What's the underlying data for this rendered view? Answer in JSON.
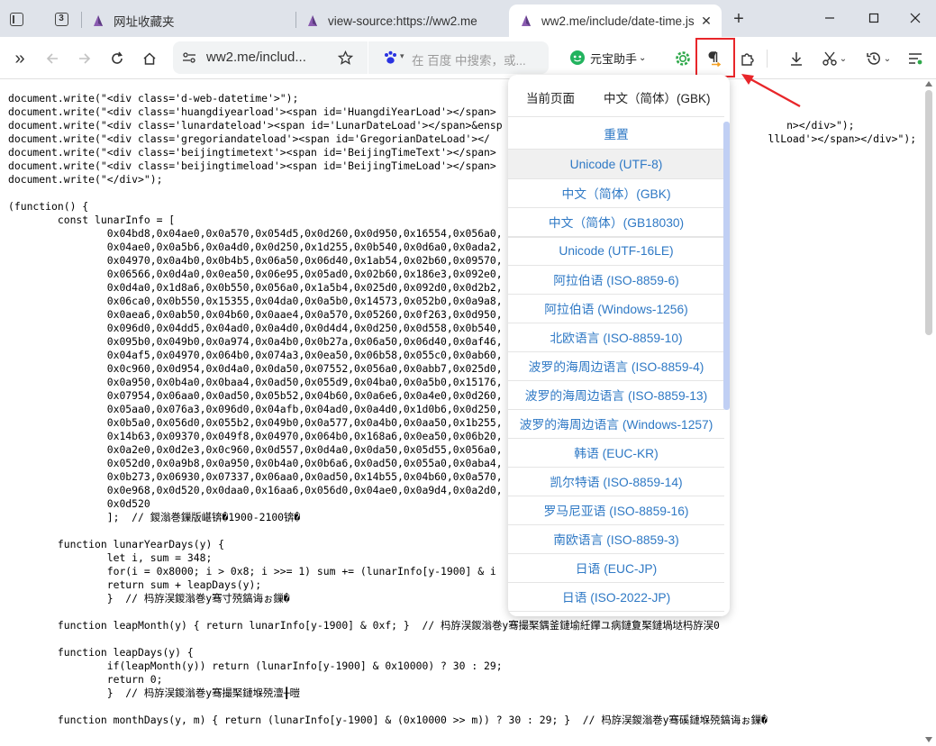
{
  "tabs": [
    {
      "title": "网址收藏夹"
    },
    {
      "title": "view-source:https://ww2.me"
    },
    {
      "title": "ww2.me/include/date-time.js"
    }
  ],
  "tab_counter": "3",
  "address_bar": {
    "url": "ww2.me/includ..."
  },
  "search_box": {
    "placeholder": "在 百度 中搜索，或..."
  },
  "assistant": {
    "label": "元宝助手"
  },
  "encoding_menu": {
    "header_left": "当前页面",
    "header_right": "中文（简体）(GBK)",
    "reset": "重置",
    "items": [
      "Unicode (UTF-8)",
      "中文（简体）(GBK)",
      "中文（简体）(GB18030)",
      "Unicode (UTF-16LE)",
      "阿拉伯语 (ISO-8859-6)",
      "阿拉伯语 (Windows-1256)",
      "北欧语言 (ISO-8859-10)",
      "波罗的海周边语言 (ISO-8859-4)",
      "波罗的海周边语言 (ISO-8859-13)",
      "波罗的海周边语言 (Windows-1257)",
      "韩语 (EUC-KR)",
      "凯尔特语 (ISO-8859-14)",
      "罗马尼亚语 (ISO-8859-16)",
      "南欧语言 (ISO-8859-3)",
      "日语 (EUC-JP)",
      "日语 (ISO-2022-JP)"
    ],
    "selected": "Unicode (UTF-8)"
  },
  "source_lines": [
    "document.write(\"<div class='d-web-datetime'>\");",
    "document.write(\"<div class='huangdiyearload'><span id='HuangdiYearLoad'></span>",
    "document.write(\"<div class='lunardateload'><span id='LunarDateLoad'></span>&ensp                                              n></div>\");",
    "document.write(\"<div class='gregoriandateload'><span id='GregorianDateLoad'></                                             llLoad'></span></div>\");",
    "document.write(\"<div class='beijingtimetext'><span id='BeijingTimeText'></span>",
    "document.write(\"<div class='beijingtimeload'><span id='BeijingTimeLoad'></span>",
    "document.write(\"</div>\");",
    "",
    "(function() {",
    "        const lunarInfo = [",
    "                0x04bd8,0x04ae0,0x0a570,0x054d5,0x0d260,0x0d950,0x16554,0x056a0,",
    "                0x04ae0,0x0a5b6,0x0a4d0,0x0d250,0x1d255,0x0b540,0x0d6a0,0x0ada2,",
    "                0x04970,0x0a4b0,0x0b4b5,0x06a50,0x06d40,0x1ab54,0x02b60,0x09570,",
    "                0x06566,0x0d4a0,0x0ea50,0x06e95,0x05ad0,0x02b60,0x186e3,0x092e0,",
    "                0x0d4a0,0x1d8a6,0x0b550,0x056a0,0x1a5b4,0x025d0,0x092d0,0x0d2b2,",
    "                0x06ca0,0x0b550,0x15355,0x04da0,0x0a5b0,0x14573,0x052b0,0x0a9a8,",
    "                0x0aea6,0x0ab50,0x04b60,0x0aae4,0x0a570,0x05260,0x0f263,0x0d950,",
    "                0x096d0,0x04dd5,0x04ad0,0x0a4d0,0x0d4d4,0x0d250,0x0d558,0x0b540,",
    "                0x095b0,0x049b0,0x0a974,0x0a4b0,0x0b27a,0x06a50,0x06d40,0x0af46,",
    "                0x04af5,0x04970,0x064b0,0x074a3,0x0ea50,0x06b58,0x055c0,0x0ab60,",
    "                0x0c960,0x0d954,0x0d4a0,0x0da50,0x07552,0x056a0,0x0abb7,0x025d0,",
    "                0x0a950,0x0b4a0,0x0baa4,0x0ad50,0x055d9,0x04ba0,0x0a5b0,0x15176,",
    "                0x07954,0x06aa0,0x0ad50,0x05b52,0x04b60,0x0a6e6,0x0a4e0,0x0d260,",
    "                0x05aa0,0x076a3,0x096d0,0x04afb,0x04ad0,0x0a4d0,0x1d0b6,0x0d250,",
    "                0x0b5a0,0x056d0,0x055b2,0x049b0,0x0a577,0x0a4b0,0x0aa50,0x1b255,",
    "                0x14b63,0x09370,0x049f8,0x04970,0x064b0,0x168a6,0x0ea50,0x06b20,",
    "                0x0a2e0,0x0d2e3,0x0c960,0x0d557,0x0d4a0,0x0da50,0x05d55,0x056a0,",
    "                0x052d0,0x0a9b8,0x0a950,0x0b4a0,0x0b6a6,0x0ad50,0x055a0,0x0aba4,",
    "                0x0b273,0x06930,0x07337,0x06aa0,0x0ad50,0x14b55,0x04b60,0x0a570,",
    "                0x0e968,0x0d520,0x0daa0,0x16aa6,0x056d0,0x04ae0,0x0a9d4,0x0a2d0,",
    "                0x0d520",
    "                ];  // 鍐滃巻鏁版嵁锛�1900-2100锛�",
    "",
    "        function lunarYearDays(y) {",
    "                let i, sum = 348;",
    "                for(i = 0x8000; i > 0x8; i >>= 1) sum += (lunarInfo[y-1900] & i",
    "                return sum + leapDays(y);",
    "                }  // 杩斿洖鍐滃巻y骞寸殑鎬诲ぉ鏁�",
    "",
    "        function leapMonth(y) { return lunarInfo[y-1900] & 0xf; }  // 杩斿洖鍐滃巻y骞撮棸鍝釜鏈堬紝鑻ユ病鏈夐棸鏈堝垯杩斿洖0",
    "",
    "        function leapDays(y) {",
    "                if(leapMonth(y)) return (lunarInfo[y-1900] & 0x10000) ? 30 : 29;",
    "                return 0;",
    "                }  // 杩斿洖鍐滃巻y骞撮棸鏈堢殑澶╂暟",
    "",
    "        function monthDays(y, m) { return (lunarInfo[y-1900] & (0x10000 >> m)) ? 30 : 29; }  // 杩斿洖鍐滃巻y骞磎鏈堢殑鎬诲ぉ鏁�"
  ]
}
